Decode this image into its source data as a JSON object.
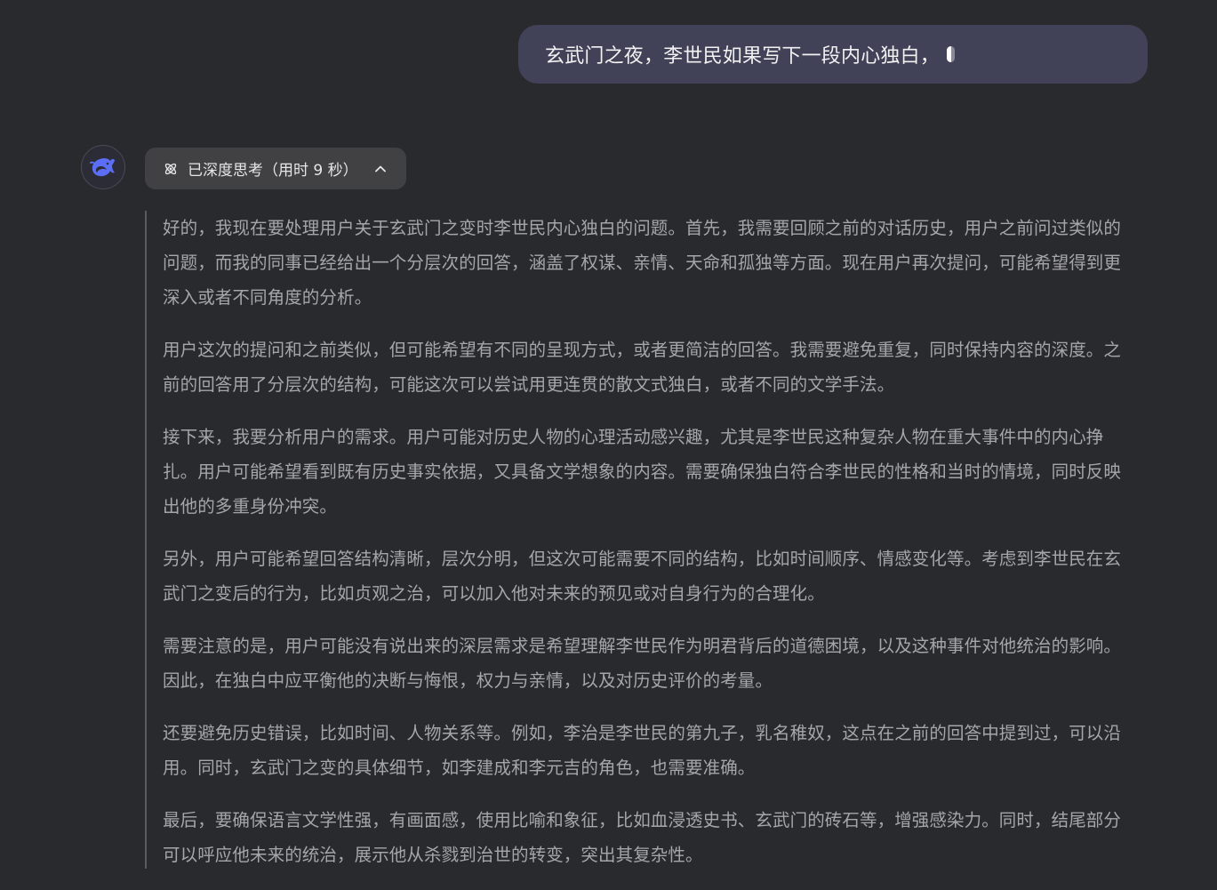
{
  "user_message": {
    "text": "玄武门之夜，李世民如果写下一段内心独白，"
  },
  "assistant": {
    "avatar_icon": "deepseek-whale-icon",
    "think_toggle": {
      "icon": "atom-icon",
      "label": "已深度思考（用时 9 秒）",
      "chevron_icon": "chevron-up-icon"
    },
    "thought_paragraphs": [
      "好的，我现在要处理用户关于玄武门之变时李世民内心独白的问题。首先，我需要回顾之前的对话历史，用户之前问过类似的问题，而我的同事已经给出一个分层次的回答，涵盖了权谋、亲情、天命和孤独等方面。现在用户再次提问，可能希望得到更深入或者不同角度的分析。",
      "用户这次的提问和之前类似，但可能希望有不同的呈现方式，或者更简洁的回答。我需要避免重复，同时保持内容的深度。之前的回答用了分层次的结构，可能这次可以尝试用更连贯的散文式独白，或者不同的文学手法。",
      "接下来，我要分析用户的需求。用户可能对历史人物的心理活动感兴趣，尤其是李世民这种复杂人物在重大事件中的内心挣扎。用户可能希望看到既有历史事实依据，又具备文学想象的内容。需要确保独白符合李世民的性格和当时的情境，同时反映出他的多重身份冲突。",
      "另外，用户可能希望回答结构清晰，层次分明，但这次可能需要不同的结构，比如时间顺序、情感变化等。考虑到李世民在玄武门之变后的行为，比如贞观之治，可以加入他对未来的预见或对自身行为的合理化。",
      "需要注意的是，用户可能没有说出来的深层需求是希望理解李世民作为明君背后的道德困境，以及这种事件对他统治的影响。因此，在独白中应平衡他的决断与悔恨，权力与亲情，以及对历史评价的考量。",
      "还要避免历史错误，比如时间、人物关系等。例如，李治是李世民的第九子，乳名稚奴，这点在之前的回答中提到过，可以沿用。同时，玄武门之变的具体细节，如李建成和李元吉的角色，也需要准确。",
      "最后，要确保语言文学性强，有画面感，使用比喻和象征，比如血浸透史书、玄武门的砖石等，增强感染力。同时，结尾部分可以呼应他未来的统治，展示他从杀戮到治世的转变，突出其复杂性。"
    ]
  }
}
